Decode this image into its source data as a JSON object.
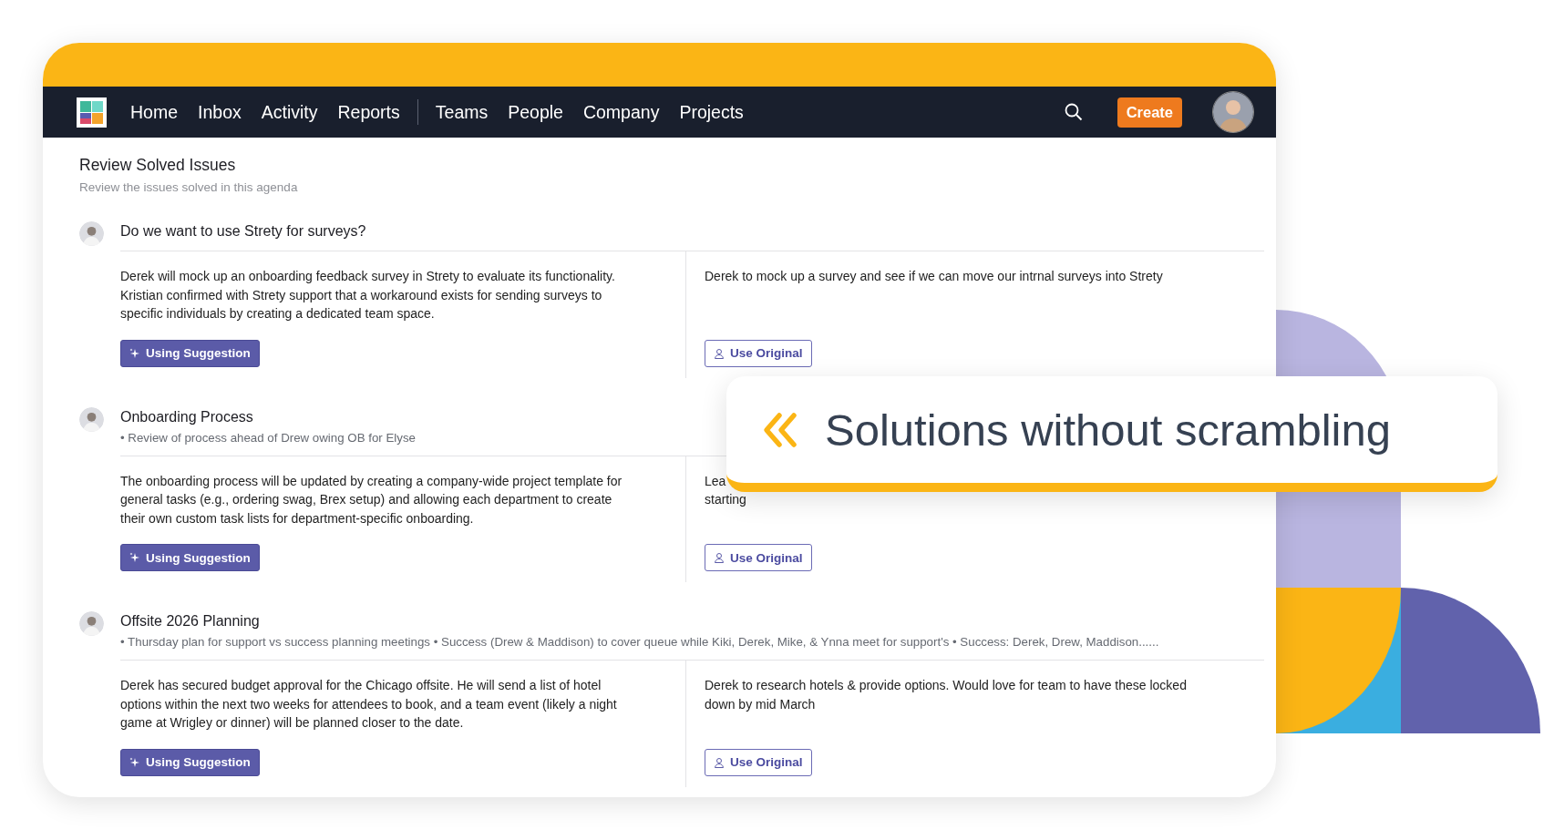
{
  "nav": {
    "groups": [
      [
        "Home",
        "Inbox",
        "Activity",
        "Reports"
      ],
      [
        "Teams",
        "People",
        "Company",
        "Projects"
      ]
    ],
    "create_button": "Create"
  },
  "section": {
    "title": "Review Solved Issues",
    "subtitle": "Review the issues solved in this agenda"
  },
  "issues": [
    {
      "title": "Do we want to use Strety for surveys?",
      "left_text": "Derek will mock up an onboarding feedback survey in Strety to evaluate its functionality. Kristian confirmed with Strety support that a workaround exists for sending surveys to specific individuals by creating a dedicated team space.",
      "right_text": "Derek to mock up a survey and see if we can move our intrnal surveys into Strety",
      "choices": [
        {
          "label": "Using Suggestion",
          "kind": "suggestion",
          "selected": true
        },
        {
          "label": "Use Original",
          "kind": "original",
          "selected": false
        }
      ]
    },
    {
      "title": "Onboarding Process",
      "summary": "• Review of process ahead of Drew owing OB for Elyse",
      "left_text": "The onboarding process will be updated by creating a company-wide project template for general tasks (e.g., ordering swag, Brex setup) and allowing each department to create their own custom task lists for department-specific onboarding.",
      "right_text": "Lea\nstarting",
      "choices": [
        {
          "label": "Using Suggestion",
          "kind": "suggestion",
          "selected": true
        },
        {
          "label": "Use Original",
          "kind": "original",
          "selected": false
        }
      ]
    },
    {
      "title": "Offsite 2026 Planning",
      "summary": "• Thursday plan for support vs success planning meetings • Success (Drew & Maddison) to cover queue while Kiki, Derek, Mike, & Ynna meet for support's • Success: Derek, Drew, Maddison......",
      "left_text": "Derek has secured budget approval for the Chicago offsite. He will send a list of hotel options within the next two weeks for attendees to book, and a team event (likely a night game at Wrigley or dinner) will be planned closer to the date.",
      "right_text": "Derek to research hotels & provide options. Would love for team to have these locked down by mid March",
      "choices": [
        {
          "label": "Using Suggestion",
          "kind": "suggestion",
          "selected": true
        },
        {
          "label": "Use Original",
          "kind": "original",
          "selected": false
        }
      ]
    }
  ],
  "callout": {
    "text": "Solutions without scrambling"
  }
}
